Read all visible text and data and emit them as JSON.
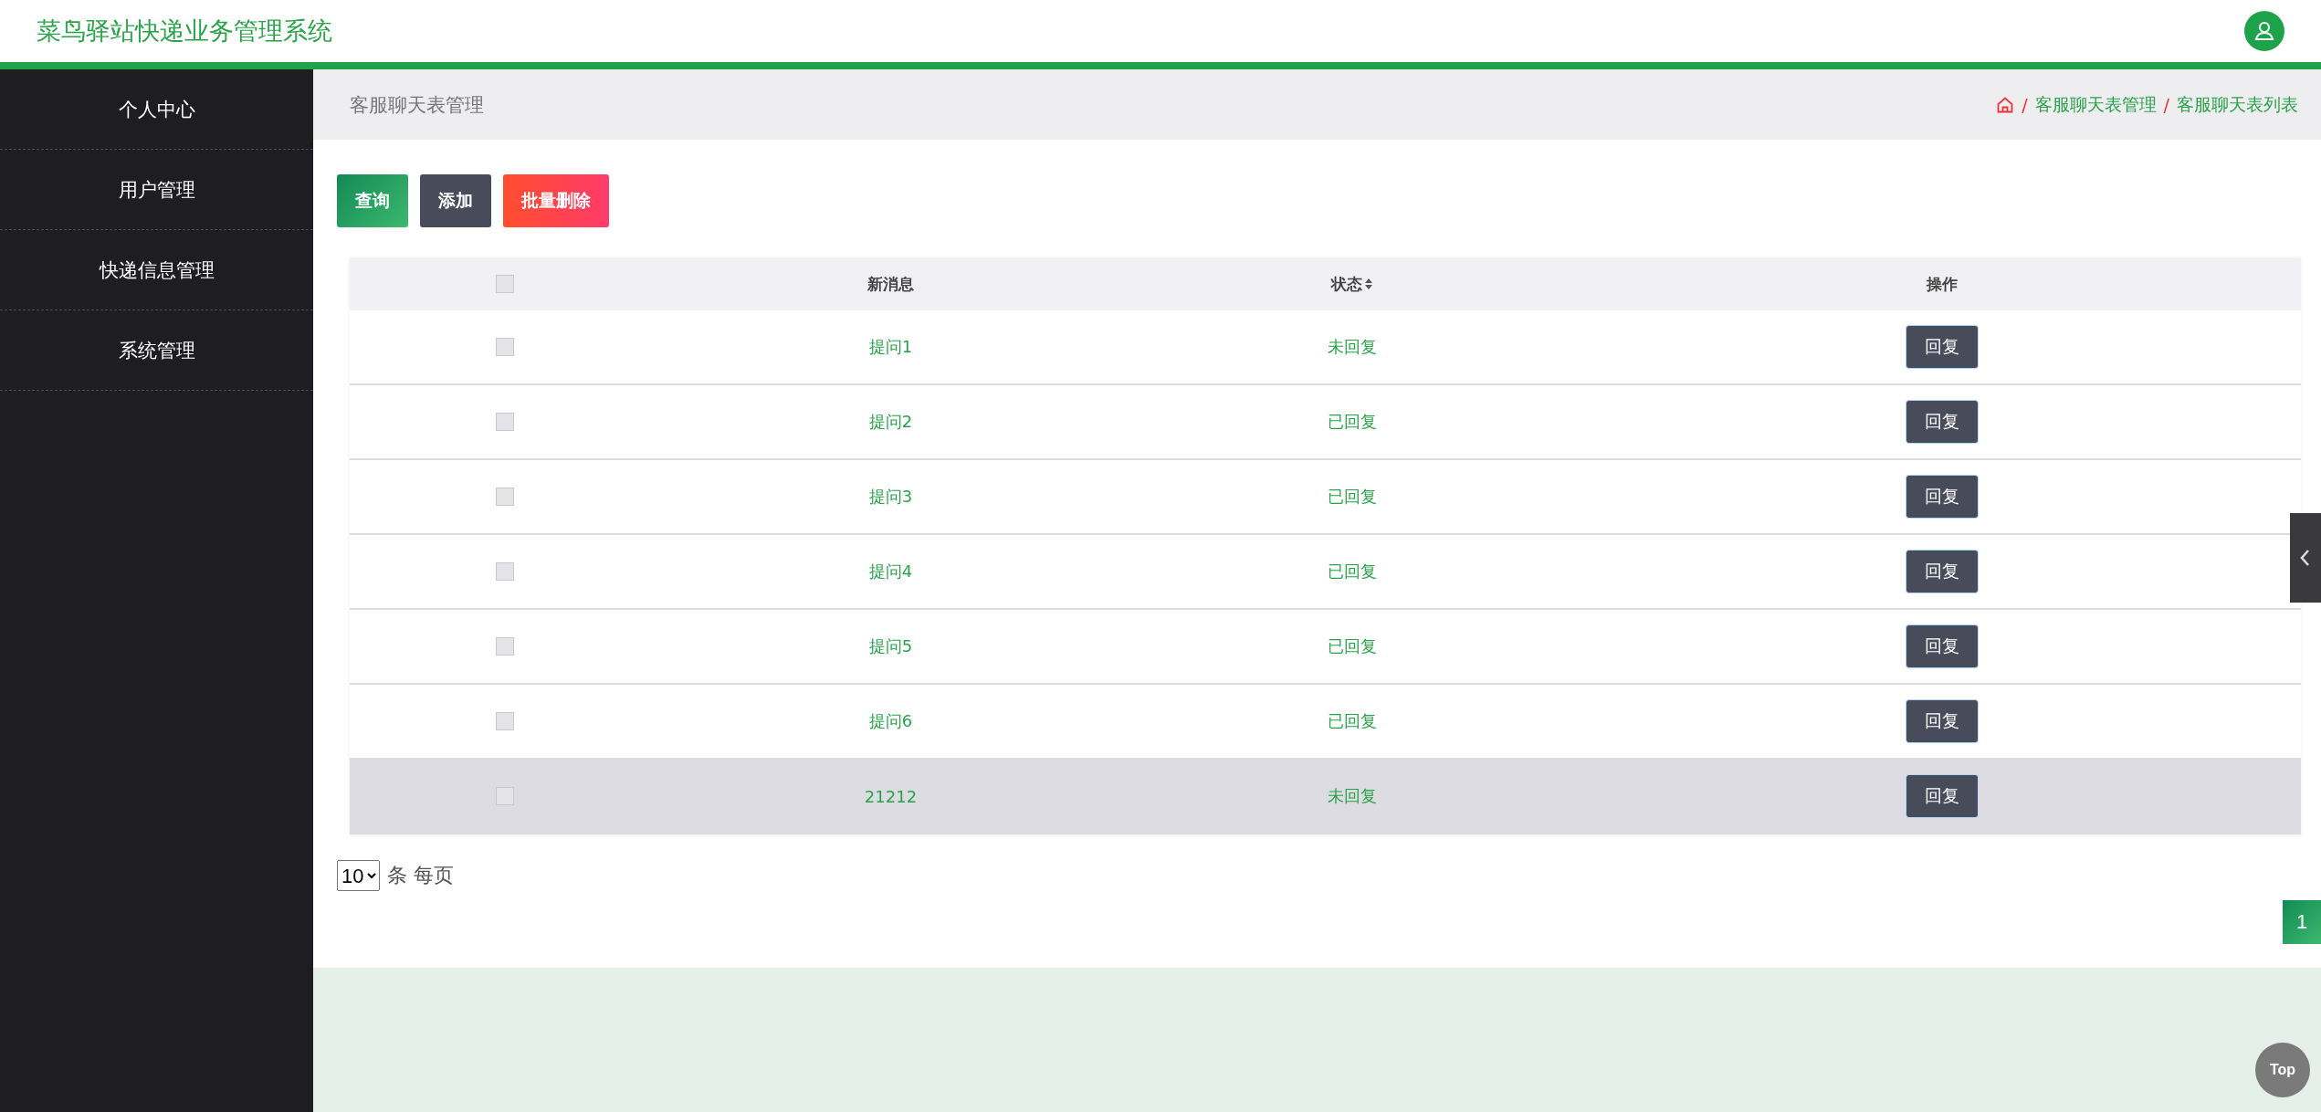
{
  "header": {
    "title": "菜鸟驿站快递业务管理系统"
  },
  "sidebar": {
    "items": [
      {
        "label": "个人中心"
      },
      {
        "label": "用户管理"
      },
      {
        "label": "快递信息管理"
      },
      {
        "label": "系统管理"
      }
    ]
  },
  "breadcrumb_bar": {
    "title": "客服聊天表管理",
    "trail": [
      {
        "separator": "/",
        "label": "客服聊天表管理"
      },
      {
        "separator": "/",
        "label": "客服聊天表列表"
      }
    ]
  },
  "actions": [
    {
      "label": "查询",
      "kind": "search"
    },
    {
      "label": "添加",
      "kind": "add"
    },
    {
      "label": "批量删除",
      "kind": "delete"
    }
  ],
  "table": {
    "select_all": {
      "checked": false
    },
    "columns": [
      "新消息",
      "状态",
      "操作"
    ],
    "rows": [
      {
        "checked": false,
        "highlighted": false,
        "message": "提问1",
        "status": "未回复",
        "action": "回复"
      },
      {
        "checked": false,
        "highlighted": false,
        "message": "提问2",
        "status": "已回复",
        "action": "回复"
      },
      {
        "checked": false,
        "highlighted": false,
        "message": "提问3",
        "status": "已回复",
        "action": "回复"
      },
      {
        "checked": false,
        "highlighted": false,
        "message": "提问4",
        "status": "已回复",
        "action": "回复"
      },
      {
        "checked": false,
        "highlighted": false,
        "message": "提问5",
        "status": "已回复",
        "action": "回复"
      },
      {
        "checked": false,
        "highlighted": false,
        "message": "提问6",
        "status": "已回复",
        "action": "回复"
      },
      {
        "checked": false,
        "highlighted": true,
        "message": "21212",
        "status": "未回复",
        "action": "回复"
      }
    ]
  },
  "pagination": {
    "page_size": "10",
    "page_size_label": "条 每页",
    "pages": [
      {
        "label": "1",
        "selected": true
      }
    ]
  },
  "back_to_top": "Top"
}
